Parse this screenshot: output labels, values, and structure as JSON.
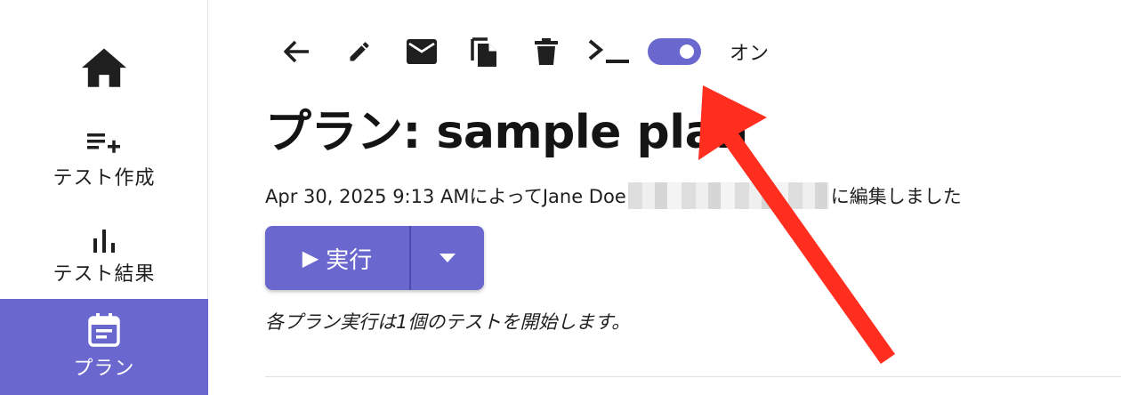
{
  "sidebar": {
    "items": [
      {
        "label": "",
        "icon": "home-icon"
      },
      {
        "label": "テスト作成",
        "icon": "playlist-add-icon"
      },
      {
        "label": "テスト結果",
        "icon": "bar-chart-icon"
      },
      {
        "label": "プラン",
        "icon": "event-note-icon",
        "active": true
      }
    ]
  },
  "toolbar": {
    "icons": [
      "back-arrow-icon",
      "edit-icon",
      "mail-icon",
      "copy-icon",
      "delete-icon",
      "terminal-icon"
    ],
    "toggle_label": "オン",
    "toggle_on": true
  },
  "page": {
    "title": "プラン: sample plan",
    "edited_prefix": "Apr 30, 2025 9:13 AMによってJane Doe",
    "edited_suffix": "に編集しました",
    "run_label": "実行",
    "run_play_glyph": "▶",
    "plan_note": "各プラン実行は1個のテストを開始します。"
  },
  "colors": {
    "accent": "#6a67ce",
    "arrow": "#ff2e1f"
  }
}
